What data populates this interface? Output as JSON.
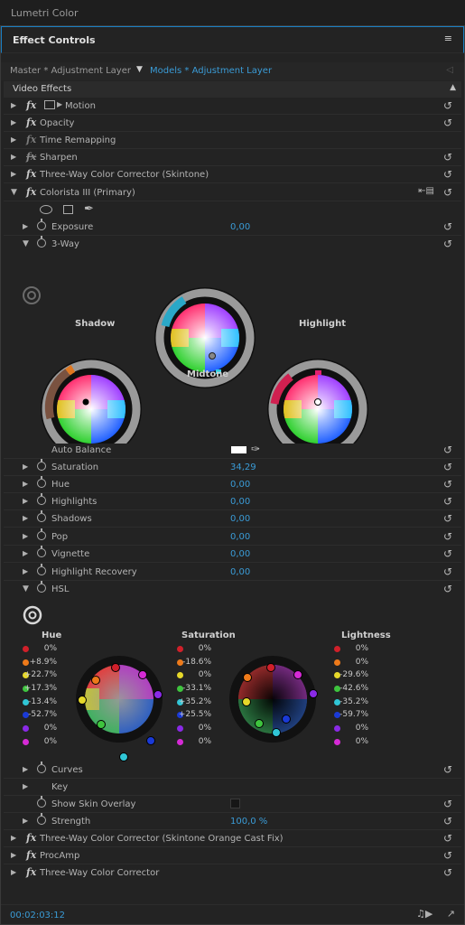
{
  "app": {
    "panel_title": "Lumetri Color"
  },
  "effect_controls": {
    "title": "Effect Controls",
    "menu_icon": "hamburger-icon"
  },
  "source": {
    "master": "Master * Adjustment Layer",
    "clip": "Models * Adjustment Layer"
  },
  "video_effects": {
    "label": "Video Effects"
  },
  "effects": {
    "motion": "Motion",
    "opacity": "Opacity",
    "time_remap": "Time Remapping",
    "sharpen": "Sharpen",
    "tw_skintone": "Three-Way Color Corrector (Skintone)",
    "colorista": "Colorista III (Primary)"
  },
  "params": {
    "exposure": {
      "label": "Exposure",
      "value": "0,00"
    },
    "three_way": {
      "label": "3-Way"
    },
    "auto_balance": {
      "label": "Auto Balance"
    },
    "saturation": {
      "label": "Saturation",
      "value": "34,29"
    },
    "hue": {
      "label": "Hue",
      "value": "0,00"
    },
    "highlights": {
      "label": "Highlights",
      "value": "0,00"
    },
    "shadows": {
      "label": "Shadows",
      "value": "0,00"
    },
    "pop": {
      "label": "Pop",
      "value": "0,00"
    },
    "vignette": {
      "label": "Vignette",
      "value": "0,00"
    },
    "highlight_recovery": {
      "label": "Highlight Recovery",
      "value": "0,00"
    },
    "hsl": {
      "label": "HSL"
    },
    "curves": {
      "label": "Curves"
    },
    "key": {
      "label": "Key"
    },
    "skin_overlay": {
      "label": "Show Skin Overlay"
    },
    "strength": {
      "label": "Strength",
      "value": "100,0 %"
    }
  },
  "wheels": {
    "shadow": "Shadow",
    "midtone": "Midtone",
    "highlight": "Highlight"
  },
  "hsl_panel": {
    "hue": {
      "title": "Hue",
      "values": [
        "0%",
        "+8.9%",
        "+22.7%",
        "+17.3%",
        "-13.4%",
        "-52.7%",
        "0%",
        "0%"
      ]
    },
    "saturation": {
      "title": "Saturation",
      "values": [
        "0%",
        "-18.6%",
        "0%",
        "-33.1%",
        "+35.2%",
        "+25.5%",
        "0%",
        "0%"
      ]
    },
    "lightness": {
      "title": "Lightness",
      "values": [
        "0%",
        "0%",
        "-29.6%",
        "-42.6%",
        "-35.2%",
        "-59.7%",
        "0%",
        "0%"
      ]
    },
    "dot_colors": [
      "#d0202a",
      "#ee7a1a",
      "#e6d82a",
      "#3ec43e",
      "#30c6d6",
      "#1a3ad6",
      "#8a2ae6",
      "#d62ad6"
    ]
  },
  "tail_effects": {
    "tw_orange": "Three-Way Color Corrector (Skintone Orange Cast Fix)",
    "procamp": "ProcAmp",
    "tw": "Three-Way Color Corrector"
  },
  "footer": {
    "timecode": "00:02:03:12"
  }
}
